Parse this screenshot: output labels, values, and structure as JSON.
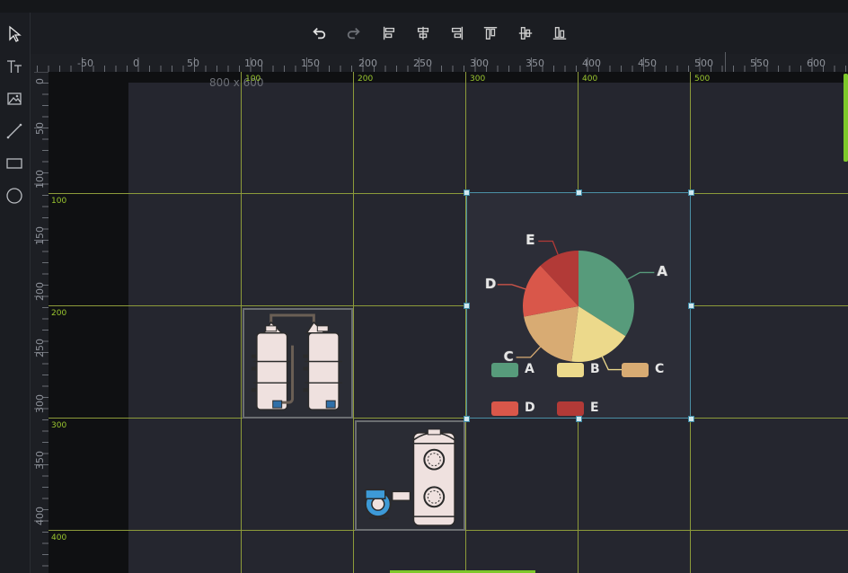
{
  "toolbar": {
    "buttons": [
      "undo-icon",
      "redo-icon",
      "align-left-icon",
      "align-center-h-icon",
      "align-right-icon",
      "align-top-icon",
      "align-middle-v-icon",
      "align-bottom-icon"
    ]
  },
  "tools": [
    "pointer-icon",
    "text-icon",
    "image-icon",
    "line-icon",
    "rectangle-icon",
    "circle-icon"
  ],
  "hruler": {
    "labels": [
      "-50",
      "0",
      "50",
      "100",
      "150",
      "200",
      "250",
      "300",
      "350",
      "400",
      "450",
      "500",
      "550",
      "600"
    ]
  },
  "vruler": {
    "labels": [
      "0",
      "50",
      "100",
      "150",
      "200",
      "250",
      "300",
      "350",
      "400"
    ]
  },
  "canvas": {
    "size_label": "800 x 600"
  },
  "guides": {
    "vertical": [
      "100",
      "200",
      "300",
      "400",
      "500"
    ],
    "horizontal": [
      "100",
      "200",
      "300",
      "400"
    ]
  },
  "colors": {
    "A": "#579b7b",
    "B": "#ecd98b",
    "C": "#d8ab73",
    "D": "#d9574a",
    "E": "#b23a37",
    "guide": "#8d9b3a",
    "accent": "#7ec82a"
  },
  "chart_data": {
    "type": "pie",
    "categories": [
      "A",
      "B",
      "C",
      "D",
      "E"
    ],
    "values": [
      34,
      18,
      20,
      16,
      12
    ],
    "legend": [
      "A",
      "B",
      "C",
      "D",
      "E"
    ]
  }
}
